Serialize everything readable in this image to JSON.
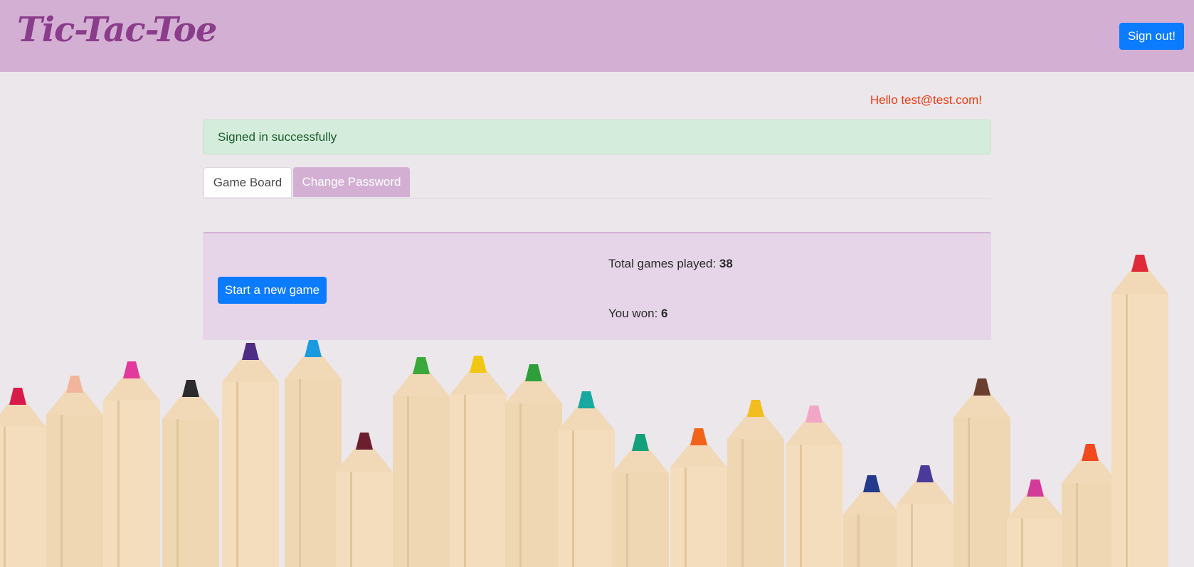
{
  "app": {
    "brand": "Tic-Tac-Toe"
  },
  "navbar": {
    "signout_label": "Sign out!"
  },
  "greeting": "Hello test@test.com!",
  "alert": {
    "message": "Signed in successfully"
  },
  "tabs": [
    {
      "label": "Game Board",
      "active": true
    },
    {
      "label": "Change Password",
      "active": false
    }
  ],
  "game_panel": {
    "start_label": "Start a new game",
    "total_label": "Total games played: ",
    "total_value": "38",
    "won_label": "You won: ",
    "won_value": "6"
  },
  "colors": {
    "navbar": "#d3b0d3",
    "brand": "#8b3c8b",
    "primary_button": "#0b7bff",
    "greeting": "#ec3b13",
    "alert_bg": "#d4ecdb",
    "panel_bg": "#e6d5e8"
  },
  "background": {
    "image": "colored-pencils-photo"
  }
}
